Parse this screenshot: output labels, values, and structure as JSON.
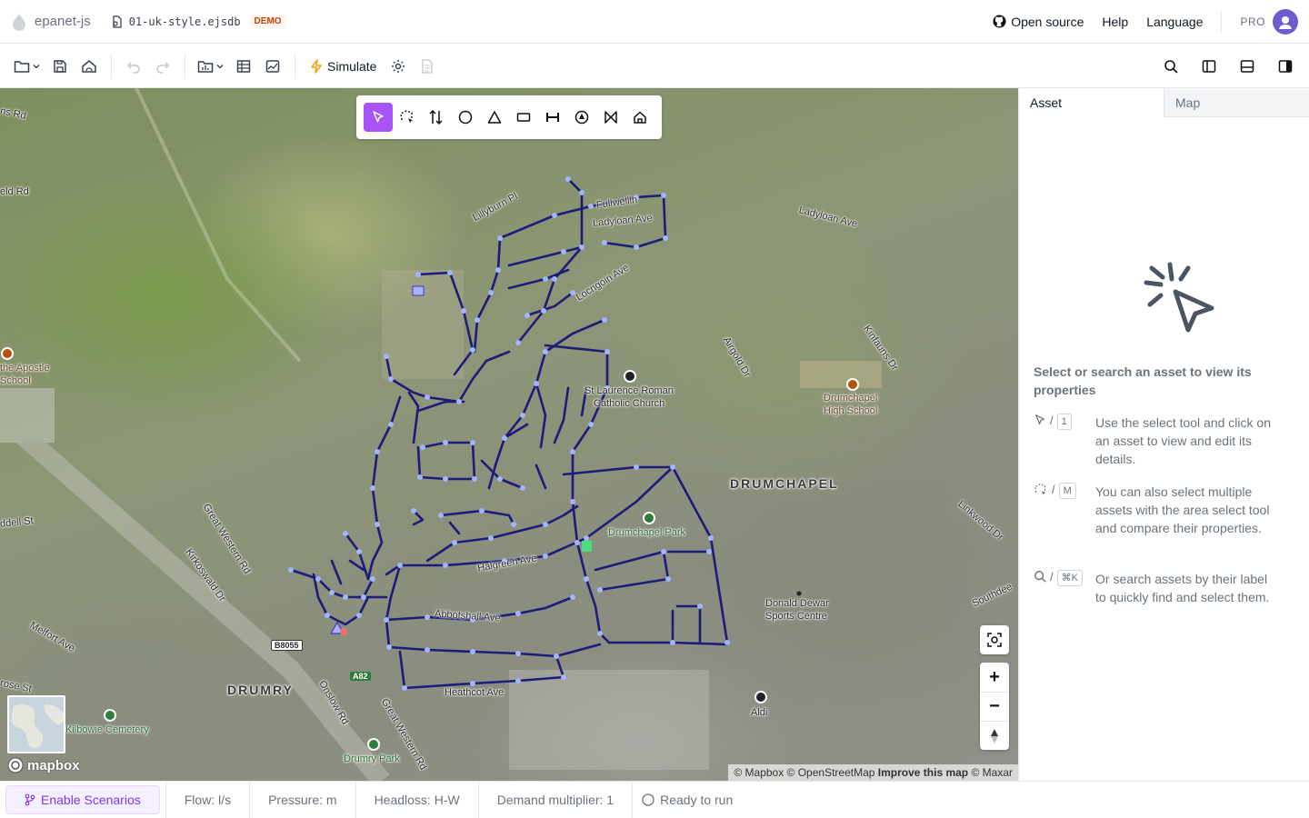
{
  "app": {
    "name": "epanet-js",
    "file_name": "01-uk-style.ejsdb",
    "demo_badge": "DEMO"
  },
  "topnav": {
    "open_source": "Open source",
    "help": "Help",
    "language": "Language",
    "pro": "PRO"
  },
  "toolbar": {
    "simulate_label": "Simulate"
  },
  "map": {
    "labels": [
      {
        "text": "ns Rd"
      },
      {
        "text": "eld Rd"
      },
      {
        "text": "Lillyburn Pl"
      },
      {
        "text": "Fullwellin"
      },
      {
        "text": "Ladyloan Ave"
      },
      {
        "text": "Ladyloan Ave"
      },
      {
        "text": "Locngoin Ave"
      },
      {
        "text": "Airgold Dr"
      },
      {
        "text": "Kinfauns Dr"
      },
      {
        "text": "St Laurence Roman"
      },
      {
        "text": "Catholic Church"
      },
      {
        "text": "Drumchapel"
      },
      {
        "text": "High School"
      },
      {
        "text": "DRUMCHAPEL"
      },
      {
        "text": "the Apostle"
      },
      {
        "text": "School"
      },
      {
        "text": "Great Western Rd"
      },
      {
        "text": "Kirkoswald Dr"
      },
      {
        "text": "ddell St"
      },
      {
        "text": "Melfort Ave"
      },
      {
        "text": "Drumchapel Park"
      },
      {
        "text": "Halgreen Ave"
      },
      {
        "text": "Abbotshall Ave"
      },
      {
        "text": "Heathcot Ave"
      },
      {
        "text": "Linkwood Dr"
      },
      {
        "text": "Southdee"
      },
      {
        "text": "Donald Dewar"
      },
      {
        "text": "Sports Centre"
      },
      {
        "text": "DRUMRY"
      },
      {
        "text": "Onslow Rd"
      },
      {
        "text": "Great Western Rd"
      },
      {
        "text": "Kilbowie Cemetery"
      },
      {
        "text": "Drumry Park"
      },
      {
        "text": "Aldi"
      },
      {
        "text": "B8055"
      },
      {
        "text": "A82"
      },
      {
        "text": "rose St"
      }
    ],
    "mapbox_logo": "mapbox",
    "attribution_1": "© Mapbox © OpenStreetMap",
    "attribution_improve": "Improve this map",
    "attribution_2": "© Maxar",
    "zoom_in": "+",
    "zoom_out": "−"
  },
  "panel": {
    "tab_asset": "Asset",
    "tab_map": "Map",
    "empty_title": "Select or search an asset to view its properties",
    "hints": [
      {
        "key": "1",
        "sep": "/",
        "text": "Use the select tool and click on an asset to view and edit its details."
      },
      {
        "key": "M",
        "sep": "/",
        "text": "You can also select multiple assets with the area select tool and compare their properties."
      },
      {
        "key": "⌘K",
        "sep": "/",
        "text": "Or search assets by their label to quickly find and select them."
      }
    ]
  },
  "footer": {
    "scenarios": "Enable Scenarios",
    "flow": "Flow: l/s",
    "pressure": "Pressure: m",
    "headloss": "Headloss: H-W",
    "demand": "Demand multiplier: 1",
    "status": "Ready to run"
  },
  "colors": {
    "accent": "#a855f7",
    "network": "#1e1b7a",
    "node": "#a5b4fc"
  }
}
